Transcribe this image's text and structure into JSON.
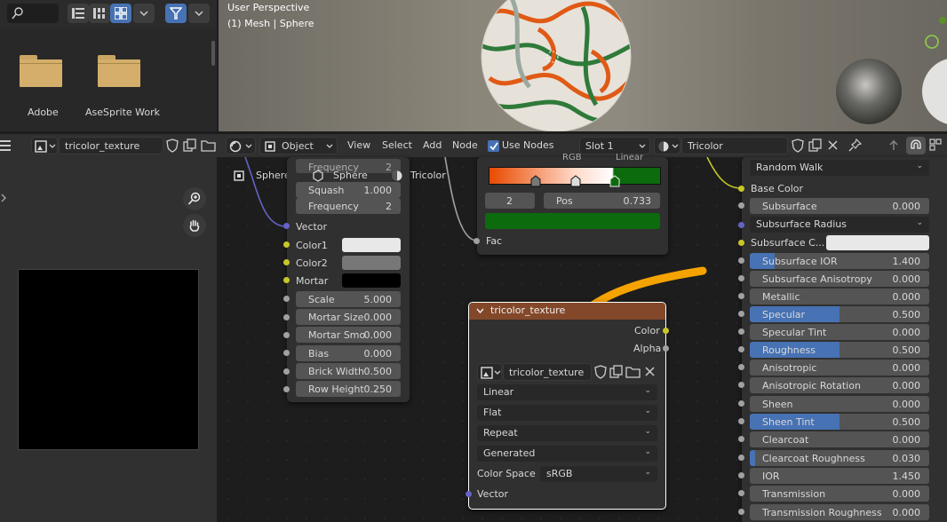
{
  "file_browser": {
    "folders": [
      {
        "name": "Adobe"
      },
      {
        "name": "AseSprite Work"
      }
    ]
  },
  "viewport": {
    "view_name": "User Perspective",
    "object_info": "(1) Mesh | Sphere"
  },
  "header": {
    "image_name": "tricolor_texture",
    "mode": "Object",
    "menu": [
      "View",
      "Select",
      "Add",
      "Node"
    ],
    "use_nodes_label": "Use Nodes",
    "slot": "Slot 1",
    "material": "Tricolor"
  },
  "breadcrumb": [
    "Sphere",
    "Sphere",
    "Tricolor"
  ],
  "brick_node": {
    "rows": [
      {
        "label": "Frequency",
        "value": "2"
      },
      {
        "label": "Squash",
        "value": "1.000"
      },
      {
        "label": "Frequency",
        "value": "2"
      }
    ],
    "inputs": {
      "vector": "Vector",
      "color1": "Color1",
      "color2": "Color2",
      "mortar": "Mortar"
    },
    "props": [
      {
        "label": "Scale",
        "value": "5.000"
      },
      {
        "label": "Mortar Size",
        "value": "0.000"
      },
      {
        "label": "Mortar Smo",
        "value": "0.000"
      },
      {
        "label": "Bias",
        "value": "0.000"
      },
      {
        "label": "Brick Width",
        "value": "0.500"
      },
      {
        "label": "Row Height",
        "value": "0.250"
      }
    ],
    "colors": {
      "color1": "#e8e8e8",
      "color2": "#777777",
      "mortar": "#000000"
    }
  },
  "ramp_node": {
    "top_left": "RGB",
    "top_right": "Linear",
    "index": "2",
    "pos_label": "Pos",
    "pos_value": "0.733",
    "fac": "Fac",
    "colors": [
      "#e84a00",
      "#ffffff",
      "#0c6b0c"
    ]
  },
  "image_node": {
    "title": "tricolor_texture",
    "outputs": {
      "color": "Color",
      "alpha": "Alpha"
    },
    "image_name": "tricolor_texture",
    "interpolation": "Linear",
    "projection": "Flat",
    "extension": "Repeat",
    "source": "Generated",
    "color_space_label": "Color Space",
    "color_space": "sRGB",
    "vector": "Vector"
  },
  "bsdf": {
    "subsurface_method": "Random Walk",
    "base_color": "Base Color",
    "rows": [
      {
        "label": "Subsurface",
        "value": "0.000",
        "fill": 0
      },
      {
        "label": "Subsurface IOR",
        "value": "1.400",
        "fill": 0.14
      },
      {
        "label": "Subsurface Anisotropy",
        "value": "0.000",
        "fill": 0
      },
      {
        "label": "Metallic",
        "value": "0.000",
        "fill": 0
      },
      {
        "label": "Specular",
        "value": "0.500",
        "fill": 0.5
      },
      {
        "label": "Specular Tint",
        "value": "0.000",
        "fill": 0
      },
      {
        "label": "Roughness",
        "value": "0.500",
        "fill": 0.5
      },
      {
        "label": "Anisotropic",
        "value": "0.000",
        "fill": 0
      },
      {
        "label": "Anisotropic Rotation",
        "value": "0.000",
        "fill": 0
      },
      {
        "label": "Sheen",
        "value": "0.000",
        "fill": 0
      },
      {
        "label": "Sheen Tint",
        "value": "0.500",
        "fill": 0.5
      },
      {
        "label": "Clearcoat",
        "value": "0.000",
        "fill": 0
      },
      {
        "label": "Clearcoat Roughness",
        "value": "0.030",
        "fill": 0.03
      },
      {
        "label": "IOR",
        "value": "1.450",
        "fill": 0
      },
      {
        "label": "Transmission",
        "value": "0.000",
        "fill": 0
      },
      {
        "label": "Transmission Roughness",
        "value": "0.000",
        "fill": 0
      }
    ],
    "subsurface_radius": "Subsurface Radius",
    "subsurface_color": "Subsurface C..."
  },
  "colors": {
    "accent": "#4772b3",
    "image_header": "#83482a",
    "arrow": "#f5a300"
  }
}
